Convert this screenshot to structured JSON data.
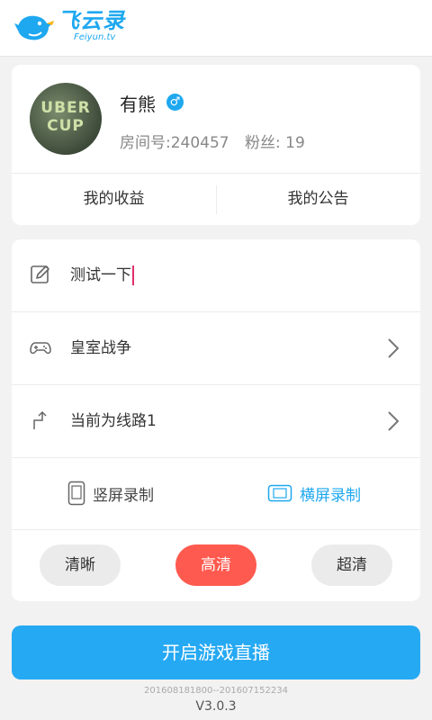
{
  "header": {
    "logo_cn": "飞云录",
    "logo_en": "Feiyun.tv"
  },
  "profile": {
    "avatar_text_line1": "UBER",
    "avatar_text_line2": "CUP",
    "name": "有熊",
    "gender_symbol": "♂",
    "room_label": "房间号:240457",
    "fans_label": "粉丝: 19",
    "actions": [
      "我的收益",
      "我的公告"
    ]
  },
  "settings": {
    "title_input_value": "测试一下",
    "game_label": "皇室战争",
    "route_label": "当前为线路1",
    "orientation": {
      "portrait_label": "竖屏录制",
      "landscape_label": "横屏录制",
      "selected": "landscape"
    },
    "quality": {
      "options": [
        "清晰",
        "高清",
        "超清"
      ],
      "selected": "高清"
    }
  },
  "start_button_label": "开启游戏直播",
  "build_string": "201608181800--201607152234",
  "version": "V3.0.3",
  "colors": {
    "accent_blue": "#26a9f3",
    "selected_red": "#ff5a4f"
  }
}
